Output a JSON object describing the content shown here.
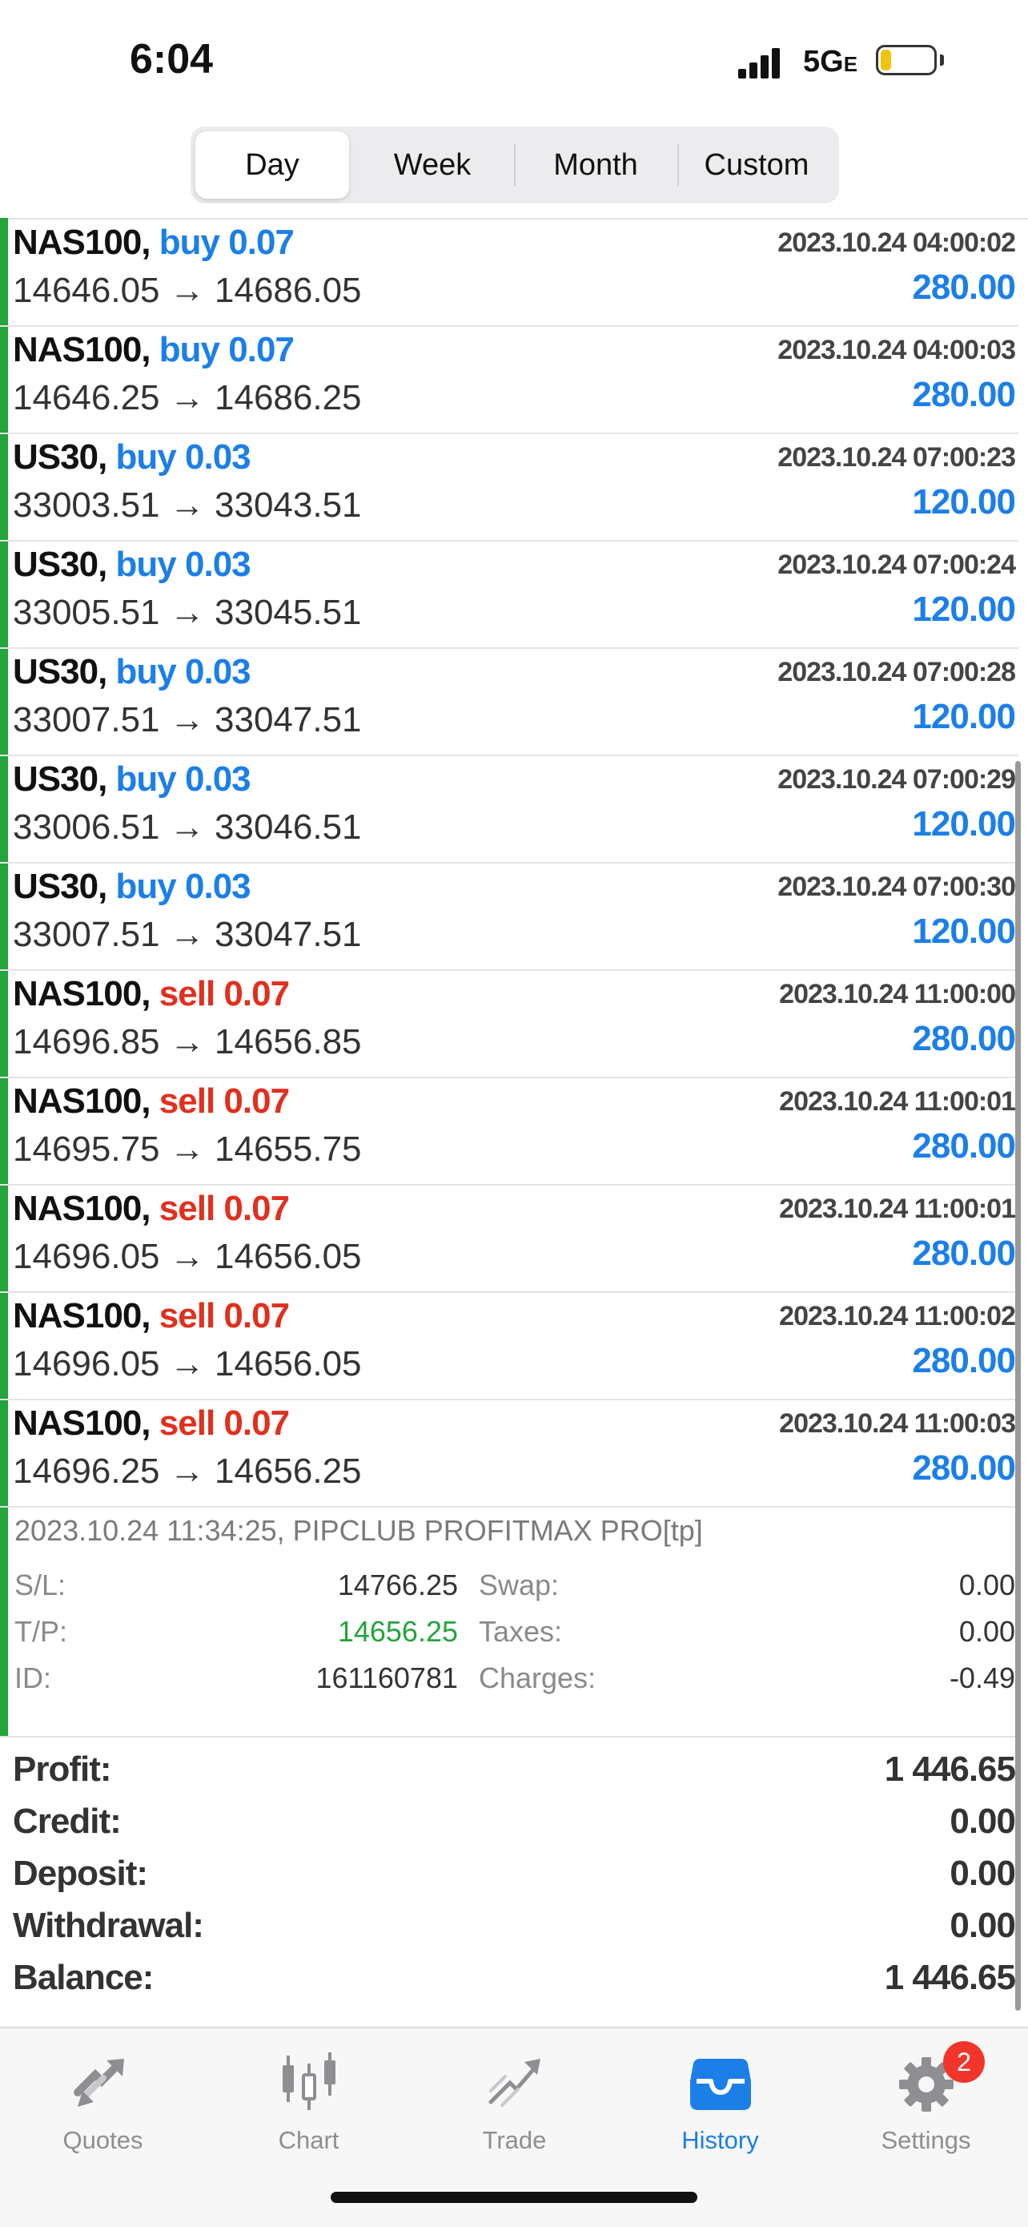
{
  "status_bar": {
    "time": "6:04",
    "network": "5G",
    "network_suffix": "E"
  },
  "period_tabs": [
    {
      "label": "Day",
      "active": true
    },
    {
      "label": "Week",
      "active": false
    },
    {
      "label": "Month",
      "active": false
    },
    {
      "label": "Custom",
      "active": false
    }
  ],
  "trades": [
    {
      "symbol": "NAS100,",
      "side": "buy",
      "volume": "0.07",
      "open": "14646.05",
      "close": "14686.05",
      "time": "2023.10.24 04:00:02",
      "profit": "280.00"
    },
    {
      "symbol": "NAS100,",
      "side": "buy",
      "volume": "0.07",
      "open": "14646.25",
      "close": "14686.25",
      "time": "2023.10.24 04:00:03",
      "profit": "280.00"
    },
    {
      "symbol": "US30,",
      "side": "buy",
      "volume": "0.03",
      "open": "33003.51",
      "close": "33043.51",
      "time": "2023.10.24 07:00:23",
      "profit": "120.00"
    },
    {
      "symbol": "US30,",
      "side": "buy",
      "volume": "0.03",
      "open": "33005.51",
      "close": "33045.51",
      "time": "2023.10.24 07:00:24",
      "profit": "120.00"
    },
    {
      "symbol": "US30,",
      "side": "buy",
      "volume": "0.03",
      "open": "33007.51",
      "close": "33047.51",
      "time": "2023.10.24 07:00:28",
      "profit": "120.00"
    },
    {
      "symbol": "US30,",
      "side": "buy",
      "volume": "0.03",
      "open": "33006.51",
      "close": "33046.51",
      "time": "2023.10.24 07:00:29",
      "profit": "120.00"
    },
    {
      "symbol": "US30,",
      "side": "buy",
      "volume": "0.03",
      "open": "33007.51",
      "close": "33047.51",
      "time": "2023.10.24 07:00:30",
      "profit": "120.00"
    },
    {
      "symbol": "NAS100,",
      "side": "sell",
      "volume": "0.07",
      "open": "14696.85",
      "close": "14656.85",
      "time": "2023.10.24 11:00:00",
      "profit": "280.00"
    },
    {
      "symbol": "NAS100,",
      "side": "sell",
      "volume": "0.07",
      "open": "14695.75",
      "close": "14655.75",
      "time": "2023.10.24 11:00:01",
      "profit": "280.00"
    },
    {
      "symbol": "NAS100,",
      "side": "sell",
      "volume": "0.07",
      "open": "14696.05",
      "close": "14656.05",
      "time": "2023.10.24 11:00:01",
      "profit": "280.00"
    },
    {
      "symbol": "NAS100,",
      "side": "sell",
      "volume": "0.07",
      "open": "14696.05",
      "close": "14656.05",
      "time": "2023.10.24 11:00:02",
      "profit": "280.00"
    },
    {
      "symbol": "NAS100,",
      "side": "sell",
      "volume": "0.07",
      "open": "14696.25",
      "close": "14656.25",
      "time": "2023.10.24 11:00:03",
      "profit": "280.00"
    }
  ],
  "arrow": "→",
  "trade_detail": {
    "title": "2023.10.24 11:34:25, PIPCLUB PROFITMAX PRO[tp]",
    "sl_label": "S/L:",
    "sl_value": "14766.25",
    "tp_label": "T/P:",
    "tp_value": "14656.25",
    "id_label": "ID:",
    "id_value": "161160781",
    "swap_label": "Swap:",
    "swap_value": "0.00",
    "taxes_label": "Taxes:",
    "taxes_value": "0.00",
    "charges_label": "Charges:",
    "charges_value": "-0.49"
  },
  "summary": [
    {
      "label": "Profit:",
      "value": "1 446.65"
    },
    {
      "label": "Credit:",
      "value": "0.00"
    },
    {
      "label": "Deposit:",
      "value": "0.00"
    },
    {
      "label": "Withdrawal:",
      "value": "0.00"
    },
    {
      "label": "Balance:",
      "value": "1 446.65"
    }
  ],
  "tab_bar": [
    {
      "label": "Quotes",
      "icon": "quotes-icon",
      "active": false
    },
    {
      "label": "Chart",
      "icon": "candlestick-icon",
      "active": false
    },
    {
      "label": "Trade",
      "icon": "trade-icon",
      "active": false
    },
    {
      "label": "History",
      "icon": "inbox-icon",
      "active": true
    },
    {
      "label": "Settings",
      "icon": "gear-icon",
      "active": false,
      "badge": "2"
    }
  ],
  "colors": {
    "buy": "#1c7fe8",
    "sell": "#e0301e",
    "profit": "#1c7fe8",
    "accent_green": "#22a53b",
    "active_tab": "#1c7fe8"
  }
}
